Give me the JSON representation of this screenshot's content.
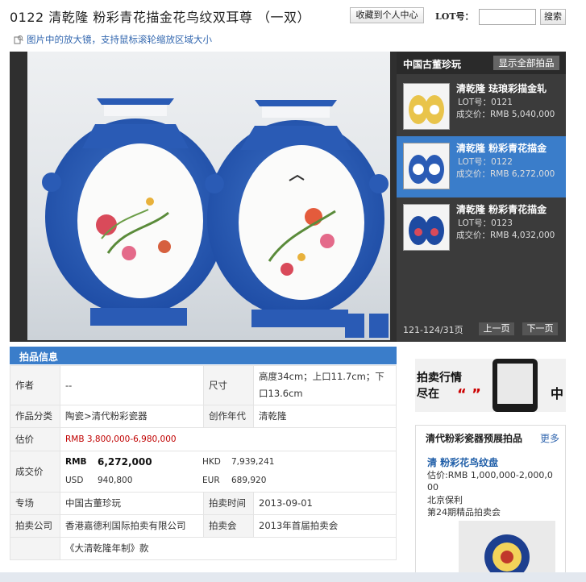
{
  "header": {
    "title": "0122 清乾隆 粉彩青花描金花鸟纹双耳尊 （一双）",
    "favorite_label": "收藏到个人中心",
    "lot_label": "LOT号：",
    "lot_input_value": "",
    "search_label": "搜索",
    "hint": "图片中的放大镜，支持鼠标滚轮缩放区域大小"
  },
  "gallery": {
    "category_title": "中国古董珍玩",
    "show_all_label": "显示全部拍品",
    "items": [
      {
        "name": "清乾隆 珐琅彩描金轧",
        "lot": "LOT号：0121",
        "price": "成交价：RMB 5,040,000",
        "active": false
      },
      {
        "name": "清乾隆 粉彩青花描金",
        "lot": "LOT号：0122",
        "price": "成交价：RMB 6,272,000",
        "active": true
      },
      {
        "name": "清乾隆 粉彩青花描金",
        "lot": "LOT号：0123",
        "price": "成交价：RMB 4,032,000",
        "active": false
      }
    ],
    "pager_text": "121-124/31页",
    "prev_label": "上一页",
    "next_label": "下一页"
  },
  "info": {
    "section_title": "拍品信息",
    "author_label": "作者",
    "author_value": "--",
    "size_label": "尺寸",
    "size_value": "高度34cm；上口11.7cm；下口13.6cm",
    "category_label": "作品分类",
    "category_value": "陶瓷>清代粉彩瓷器",
    "era_label": "创作年代",
    "era_value": "清乾隆",
    "estimate_label": "估价",
    "estimate_value": "RMB  3,800,000-6,980,000",
    "deal_label": "成交价",
    "deal": {
      "rmb_cur": "RMB",
      "rmb_val": "6,272,000",
      "hkd_cur": "HKD",
      "hkd_val": "7,939,241",
      "usd_cur": "USD",
      "usd_val": "940,800",
      "eur_cur": "EUR",
      "eur_val": "689,920"
    },
    "field_label": "专场",
    "field_value": "中国古董珍玩",
    "time_label": "拍卖时间",
    "time_value": "2013-09-01",
    "company_label": "拍卖公司",
    "company_value": "香港嘉德利国际拍卖有限公司",
    "sale_label": "拍卖会",
    "sale_value": "2013年首届拍卖会",
    "cut_row_text": "《大清乾隆年制》款"
  },
  "ad": {
    "line1": "拍卖行情",
    "line2": "尽在",
    "quote": "“ ”",
    "tail": "中"
  },
  "preview": {
    "title": "清代粉彩瓷器预展拍品",
    "more_label": "更多",
    "name": "清 粉彩花鸟纹盘",
    "estimate": "估价:RMB 1,000,000-2,000,000",
    "house": "北京保利",
    "sale": "第24期精品拍卖会"
  },
  "colors": {
    "accent": "#3a7dca",
    "price_red": "#c00000",
    "link_blue": "#3569b0",
    "gallery_bg": "#2f2f2f"
  }
}
